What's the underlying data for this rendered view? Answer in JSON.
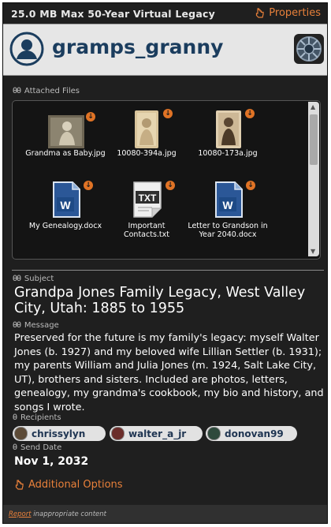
{
  "topbar": {
    "capacity": "25.0 MB Max 50-Year Virtual Legacy",
    "properties_label": "Properties"
  },
  "header": {
    "username": "gramps_granny"
  },
  "files": {
    "label": "Attached Files",
    "items": [
      {
        "name": "Grandma as Baby.jpg",
        "icon": "photo-baby"
      },
      {
        "name": "10080-394a.jpg",
        "icon": "photo-portrait-child"
      },
      {
        "name": "10080-173a.jpg",
        "icon": "photo-portrait-woman"
      },
      {
        "name": "My Genealogy.docx",
        "icon": "word-doc-icon"
      },
      {
        "name": "Important Contacts.txt",
        "icon": "txt-file-icon"
      },
      {
        "name": "Letter to Grandson in Year 2040.docx",
        "icon": "word-doc-icon"
      }
    ]
  },
  "subject": {
    "label": "Subject",
    "text": "Grandpa Jones Family Legacy, West Valley City, Utah:  1885 to 1955"
  },
  "message": {
    "label": "Message",
    "text": "Preserved for the future is my family's legacy: myself Walter Jones (b. 1927) and my beloved wife Lillian Settler (b. 1931); my parents William and Julia Jones (m. 1924, Salt Lake City, UT), brothers and sisters. Included are photos, letters, genealogy, my grandma's cookbook, my bio and history, and songs I wrote."
  },
  "recipients": {
    "label": "Recipients",
    "items": [
      {
        "name": "chrissylyn"
      },
      {
        "name": "walter_a_jr"
      },
      {
        "name": "donovan99"
      }
    ]
  },
  "send_date": {
    "label": "Send Date",
    "value": "Nov 1, 2032"
  },
  "additional_options": "Additional Options",
  "footer": {
    "report": "Report",
    "rest": " inappropriate content"
  },
  "colors": {
    "accent": "#e8803a",
    "username": "#1b3d5e",
    "panel": "#1f1f1f"
  }
}
